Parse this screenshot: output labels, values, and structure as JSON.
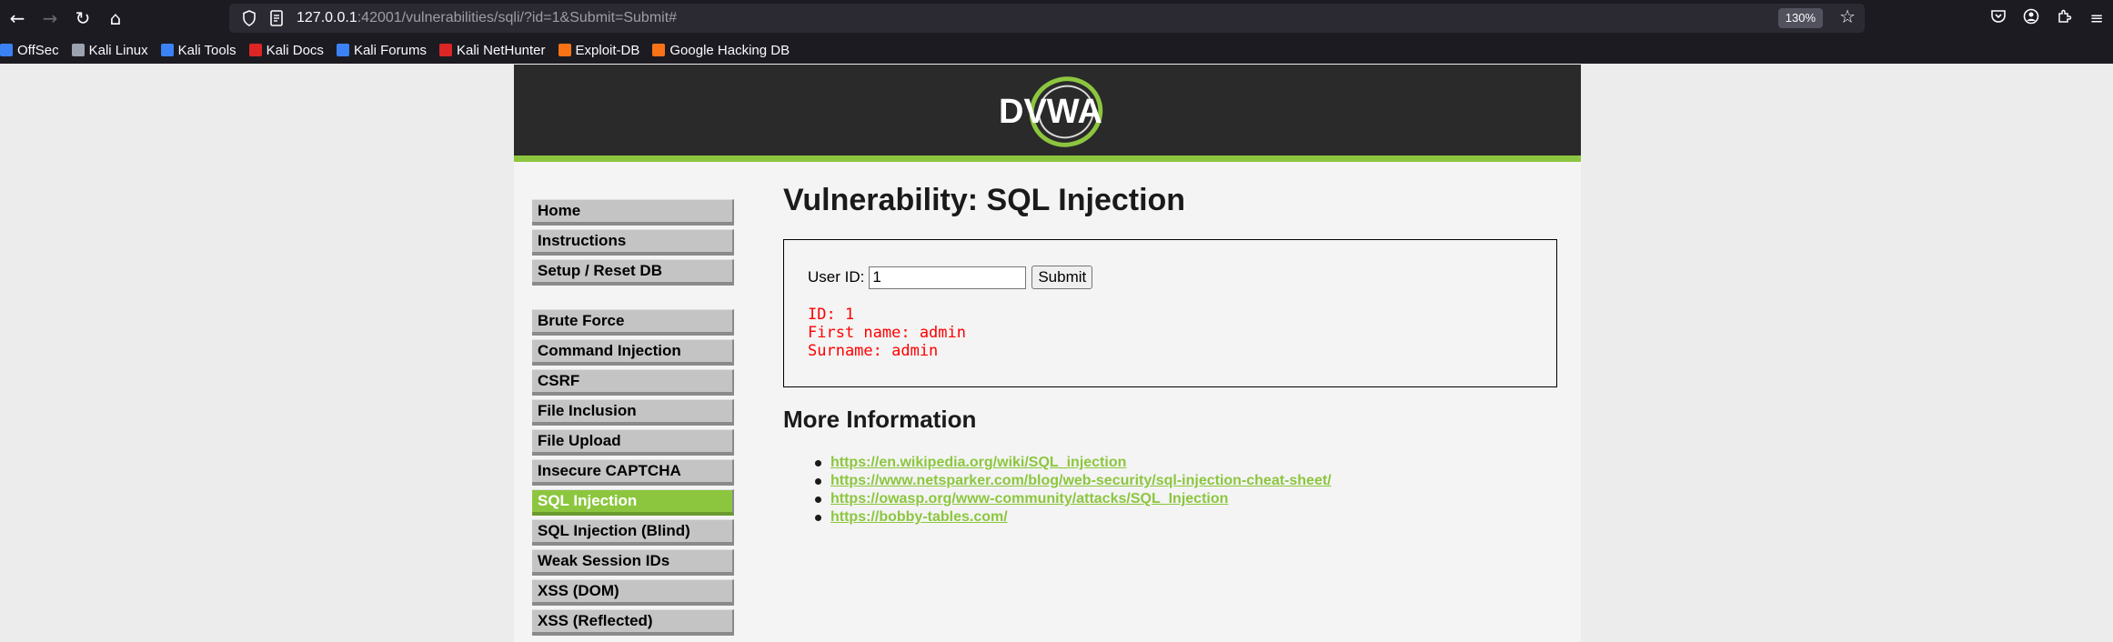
{
  "browser": {
    "url_host": "127.0.0.1",
    "url_rest": ":42001/vulnerabilities/sqli/?id=1&Submit=Submit#",
    "zoom": "130%"
  },
  "bookmarks": [
    {
      "label": "OffSec",
      "color": "#3b82f6"
    },
    {
      "label": "Kali Linux",
      "color": "#9ca3af"
    },
    {
      "label": "Kali Tools",
      "color": "#3b82f6"
    },
    {
      "label": "Kali Docs",
      "color": "#dc2626"
    },
    {
      "label": "Kali Forums",
      "color": "#3b82f6"
    },
    {
      "label": "Kali NetHunter",
      "color": "#dc2626"
    },
    {
      "label": "Exploit-DB",
      "color": "#f97316"
    },
    {
      "label": "Google Hacking DB",
      "color": "#f97316"
    }
  ],
  "logo_text": "DVWA",
  "menu": {
    "group1": [
      "Home",
      "Instructions",
      "Setup / Reset DB"
    ],
    "group2": [
      "Brute Force",
      "Command Injection",
      "CSRF",
      "File Inclusion",
      "File Upload",
      "Insecure CAPTCHA",
      "SQL Injection",
      "SQL Injection (Blind)",
      "Weak Session IDs",
      "XSS (DOM)",
      "XSS (Reflected)"
    ],
    "active": "SQL Injection"
  },
  "main": {
    "title": "Vulnerability: SQL Injection",
    "user_id_label": "User ID:",
    "user_id_value": "1",
    "submit_label": "Submit",
    "result_lines": [
      "ID: 1",
      "First name: admin",
      "Surname: admin"
    ],
    "more_title": "More Information",
    "links": [
      "https://en.wikipedia.org/wiki/SQL_injection",
      "https://www.netsparker.com/blog/web-security/sql-injection-cheat-sheet/",
      "https://owasp.org/www-community/attacks/SQL_Injection",
      "https://bobby-tables.com/"
    ]
  },
  "colors": {
    "accent": "#8cc63f",
    "header_bg": "#2a2a2a",
    "result_text": "#ff0000"
  }
}
